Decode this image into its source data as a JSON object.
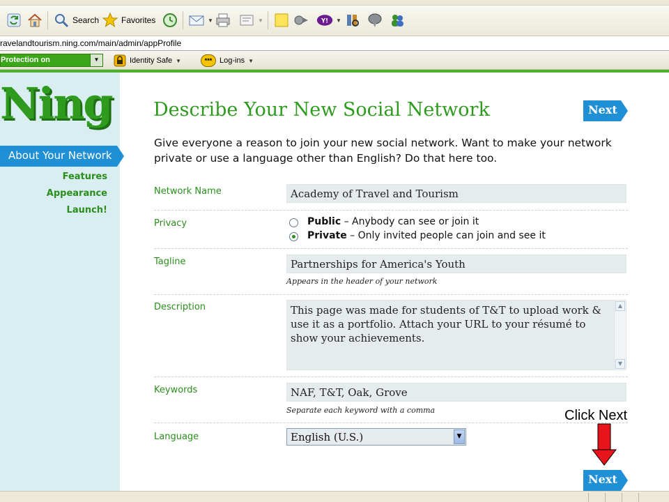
{
  "browser": {
    "toolbar": {
      "search_label": "Search",
      "favorites_label": "Favorites"
    },
    "address": "ravelandtourism.ning.com/main/admin/appProfile",
    "links_bar": {
      "protection_label": "Protection on",
      "identity_safe_label": "Identity Safe",
      "logins_label": "Log-ins",
      "logins_badge": "***"
    },
    "colors": {
      "toolbar_bg": "#ece9d8",
      "protection_green": "#3aa618",
      "accent_green": "#4caf2a"
    }
  },
  "sidebar": {
    "logo": "Ning",
    "active_step": "About Your Network",
    "steps": [
      "Features",
      "Appearance",
      "Launch!"
    ]
  },
  "main": {
    "title": "Describe Your New Social Network",
    "next_label": "Next",
    "intro": "Give everyone a reason to join your new social network. Want to make your network private or use a language other than English? Do that here too.",
    "network_name": {
      "label": "Network Name",
      "value": "Academy of Travel and Tourism"
    },
    "privacy": {
      "label": "Privacy",
      "options": [
        {
          "title": "Public",
          "desc": " – Anybody can see or join it",
          "selected": false
        },
        {
          "title": "Private",
          "desc": " – Only invited people can join and see it",
          "selected": true
        }
      ]
    },
    "tagline": {
      "label": "Tagline",
      "value": "Partnerships for America's Youth",
      "hint": "Appears in the header of your network"
    },
    "description": {
      "label": "Description",
      "value": "This page was made for students of T&T to upload work & use it as a portfolio. Attach your URL to your résumé to show your achievements."
    },
    "keywords": {
      "label": "Keywords",
      "value": "NAF, T&T, Oak, Grove",
      "hint": "Separate each keyword with a comma"
    },
    "language": {
      "label": "Language",
      "value": "English (U.S.)"
    },
    "colors": {
      "brand_green": "#2e9b1f",
      "label_green": "#2a8d1c",
      "button_blue": "#1f8fd6",
      "field_bg": "#e6ecee",
      "sidebar_bg": "#d9eef1"
    }
  },
  "annotation": {
    "text": "Click Next",
    "arrow_color": "#e8141b"
  }
}
